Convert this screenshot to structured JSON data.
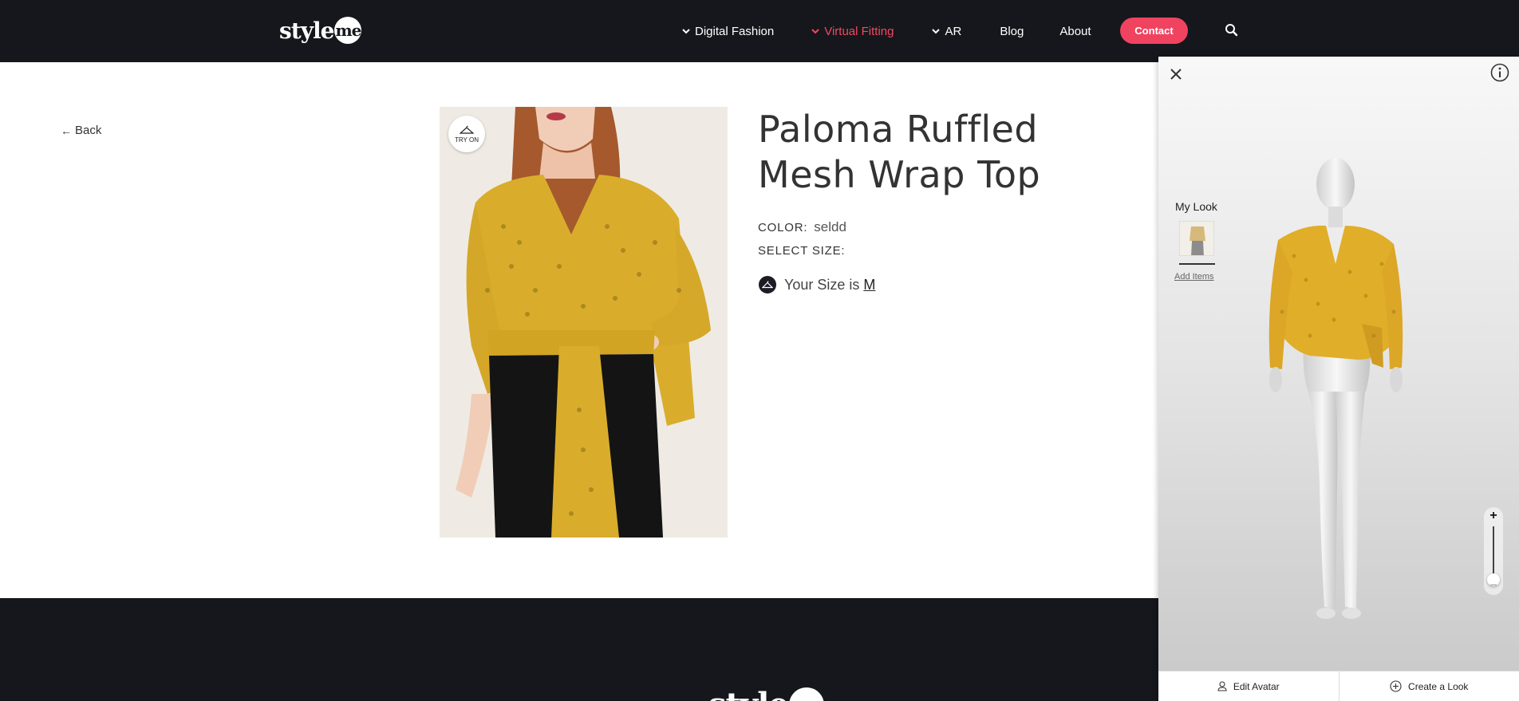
{
  "header": {
    "logo_text": "style",
    "logo_circle_text": "me",
    "nav": [
      {
        "label": "Digital Fashion",
        "has_dropdown": true,
        "active": false
      },
      {
        "label": "Virtual Fitting",
        "has_dropdown": true,
        "active": true
      },
      {
        "label": "AR",
        "has_dropdown": true,
        "active": false
      },
      {
        "label": "Blog",
        "has_dropdown": false,
        "active": false
      },
      {
        "label": "About",
        "has_dropdown": false,
        "active": false
      }
    ],
    "contact_label": "Contact",
    "search_icon": "search-icon"
  },
  "main": {
    "back_label": "Back",
    "try_on_label": "TRY ON",
    "product_title": "Paloma Ruffled Mesh Wrap Top",
    "color_label": "COLOR:",
    "color_value": "seldd",
    "size_label": "SELECT SIZE:",
    "your_size_text": "Your Size is",
    "your_size_value": "M"
  },
  "fitting_panel": {
    "my_look_title": "My Look",
    "add_items_label": "Add Items",
    "zoom_level": 0.1,
    "edit_avatar_label": "Edit Avatar",
    "create_look_label": "Create a Look"
  },
  "footer": {
    "logo_text": "style",
    "logo_circle_text": "me"
  },
  "colors": {
    "header_bg": "#16171c",
    "accent": "#ef4360",
    "garment_yellow": "#d9ad2b"
  }
}
